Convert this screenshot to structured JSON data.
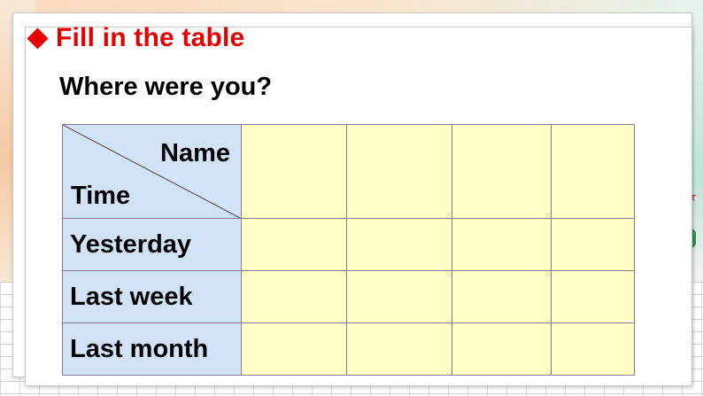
{
  "slide": {
    "heading": "Fill in the table",
    "question": "Where were you?"
  },
  "table": {
    "header": {
      "top_label": "Name",
      "bottom_label": "Time"
    },
    "blank_columns": 4,
    "rows": [
      {
        "label": "Yesterday",
        "cells": [
          "",
          "",
          "",
          ""
        ]
      },
      {
        "label": "Last week",
        "cells": [
          "",
          "",
          "",
          ""
        ]
      },
      {
        "label": "Last month",
        "cells": [
          "",
          "",
          "",
          ""
        ]
      }
    ]
  },
  "colors": {
    "accent": "#e60000",
    "label_fill": "#d3e3f7",
    "answer_fill": "#ffffc6",
    "grid_line": "#8a7a96"
  },
  "icons": {
    "bullet": "diamond-bullet-icon"
  }
}
